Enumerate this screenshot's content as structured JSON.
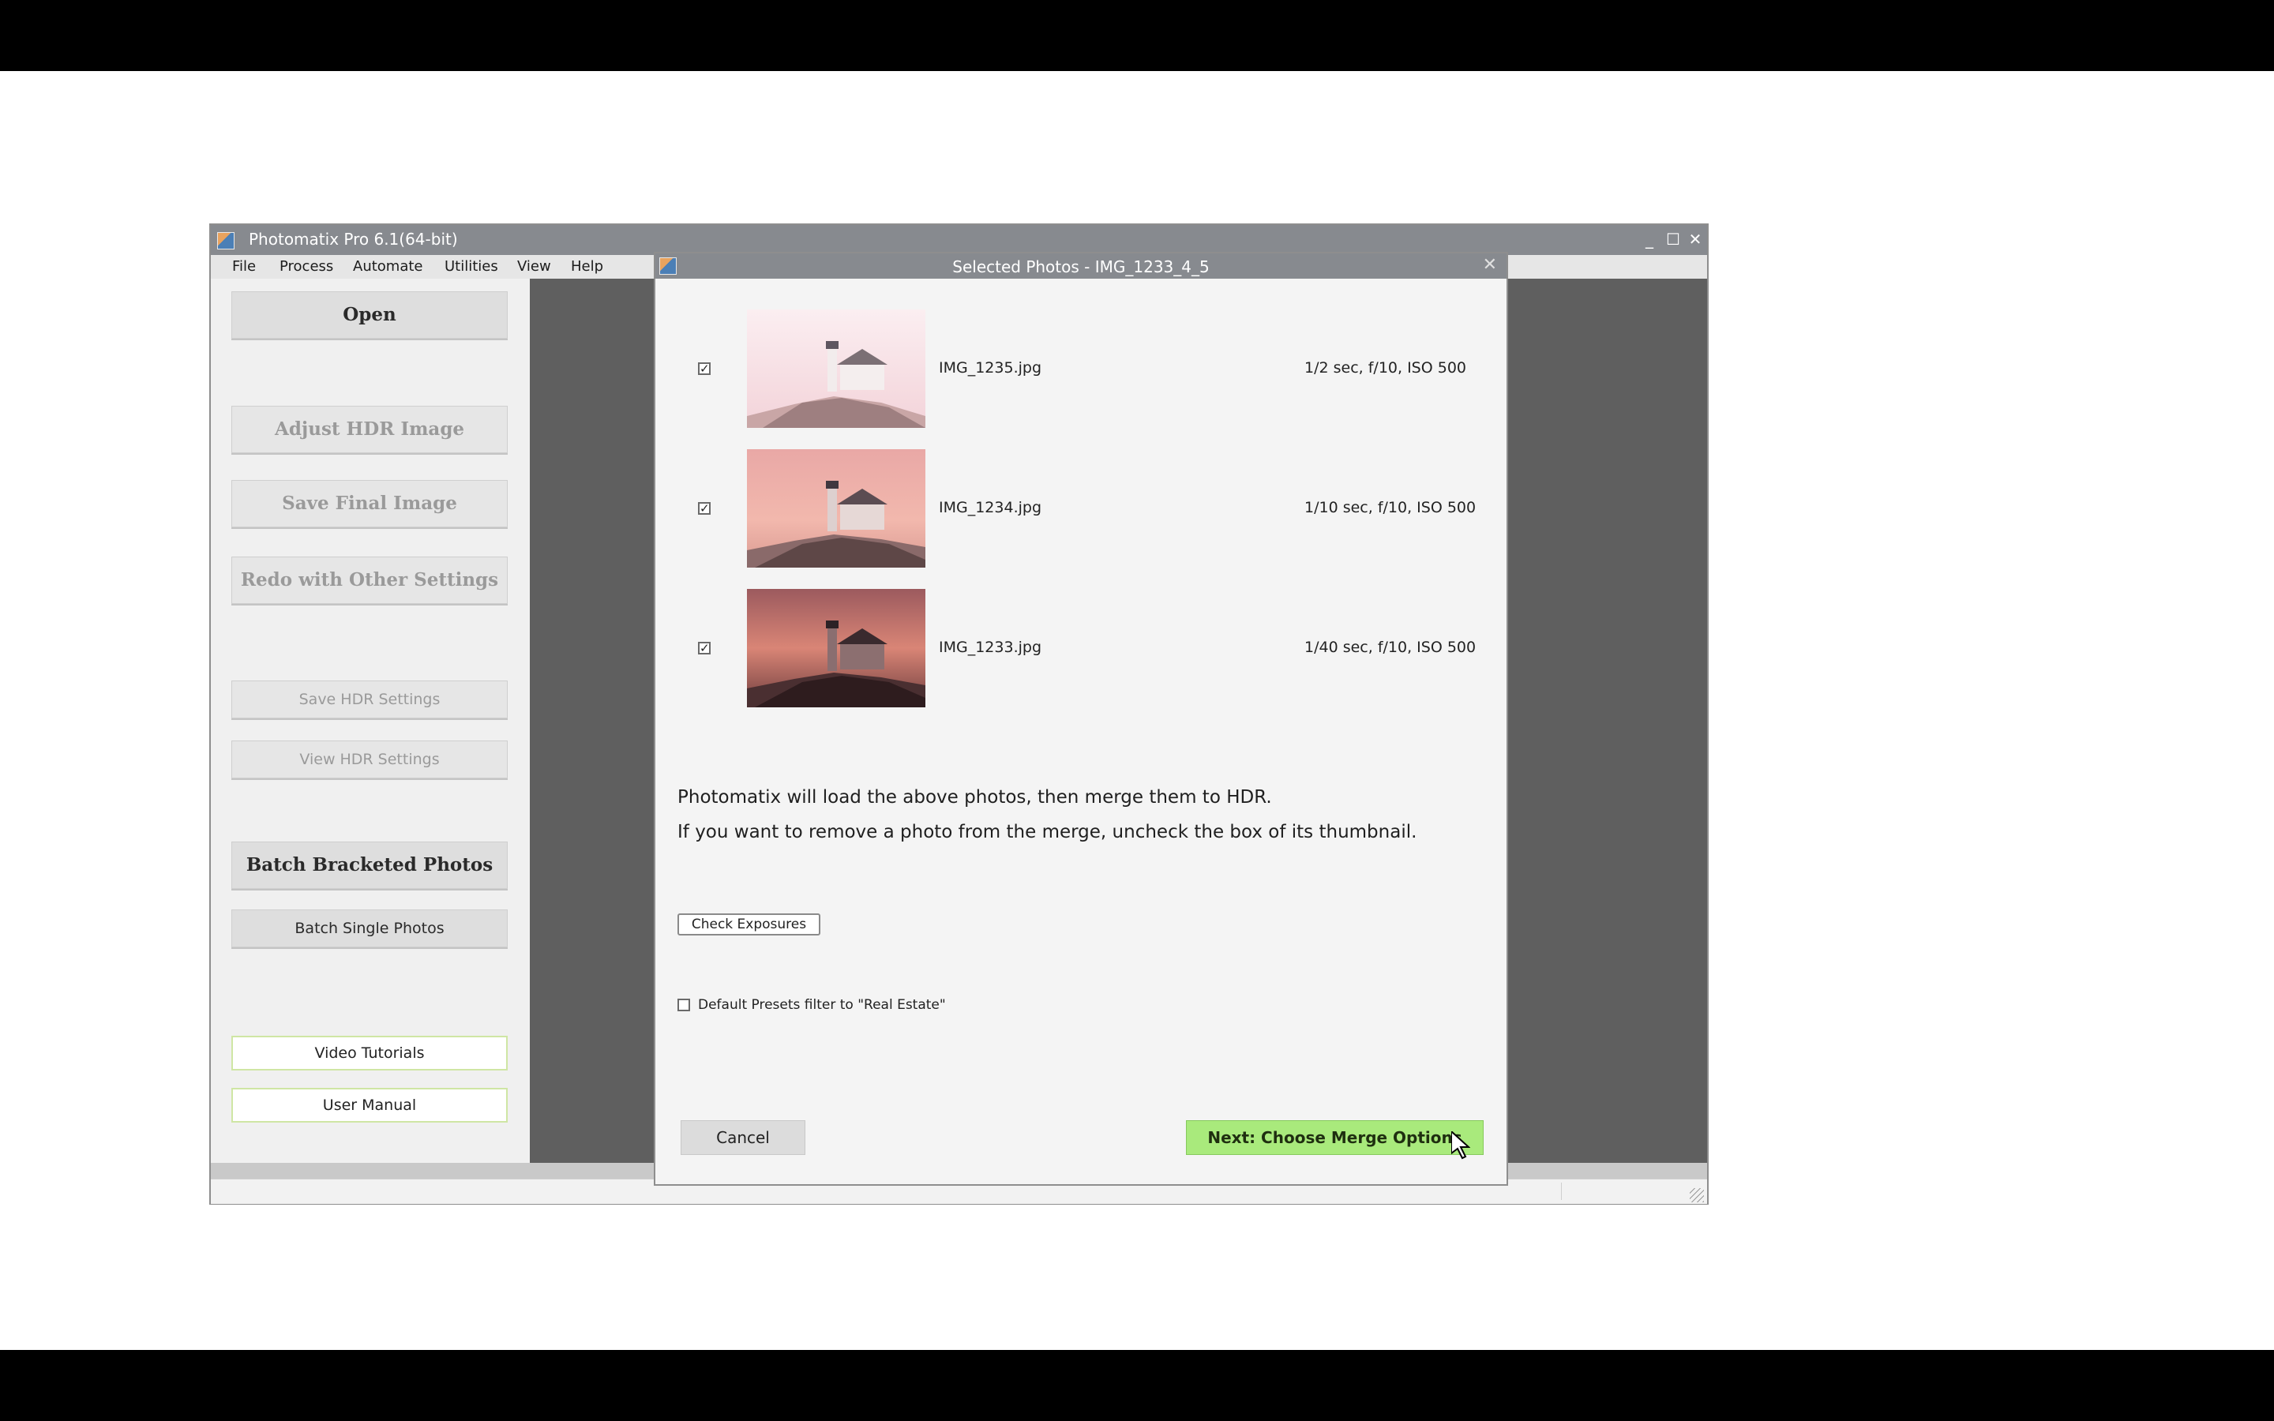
{
  "app": {
    "title": "Photomatix Pro 6.1(64-bit)",
    "window_controls": {
      "minimize": "_",
      "maximize": "☐",
      "close": "✕"
    }
  },
  "menu": [
    "File",
    "Process",
    "Automate",
    "Utilities",
    "View",
    "Help"
  ],
  "sidebar": {
    "open": "Open",
    "adjust_hdr": "Adjust HDR Image",
    "save_final": "Save Final Image",
    "redo": "Redo with Other Settings",
    "save_hdr_settings": "Save HDR Settings",
    "view_hdr_settings": "View HDR Settings",
    "batch_bracketed": "Batch Bracketed Photos",
    "batch_single": "Batch Single Photos",
    "video_tutorials": "Video Tutorials",
    "user_manual": "User Manual"
  },
  "dialog": {
    "title": "Selected Photos - IMG_1233_4_5",
    "close": "✕",
    "photos": [
      {
        "filename": "IMG_1235.jpg",
        "exif": "1/2 sec, f/10, ISO 500",
        "checked": "✓",
        "icon": "thumbnail-lighthouse-bright"
      },
      {
        "filename": "IMG_1234.jpg",
        "exif": "1/10 sec, f/10, ISO 500",
        "checked": "✓",
        "icon": "thumbnail-lighthouse-mid"
      },
      {
        "filename": "IMG_1233.jpg",
        "exif": "1/40 sec, f/10, ISO 500",
        "checked": "✓",
        "icon": "thumbnail-lighthouse-dark"
      }
    ],
    "info_line1": "Photomatix will load the above photos, then merge them to HDR.",
    "info_line2": "If you want to remove a photo from the merge, uncheck the box of its thumbnail.",
    "check_exposures": "Check Exposures",
    "preset_filter_label": "Default Presets filter to \"Real Estate\"",
    "cancel": "Cancel",
    "next": "Next: Choose Merge Options"
  },
  "colors": {
    "titlebar": "#878a8f",
    "next_button": "#a9ea7c",
    "workspace": "#5f5f5f"
  }
}
